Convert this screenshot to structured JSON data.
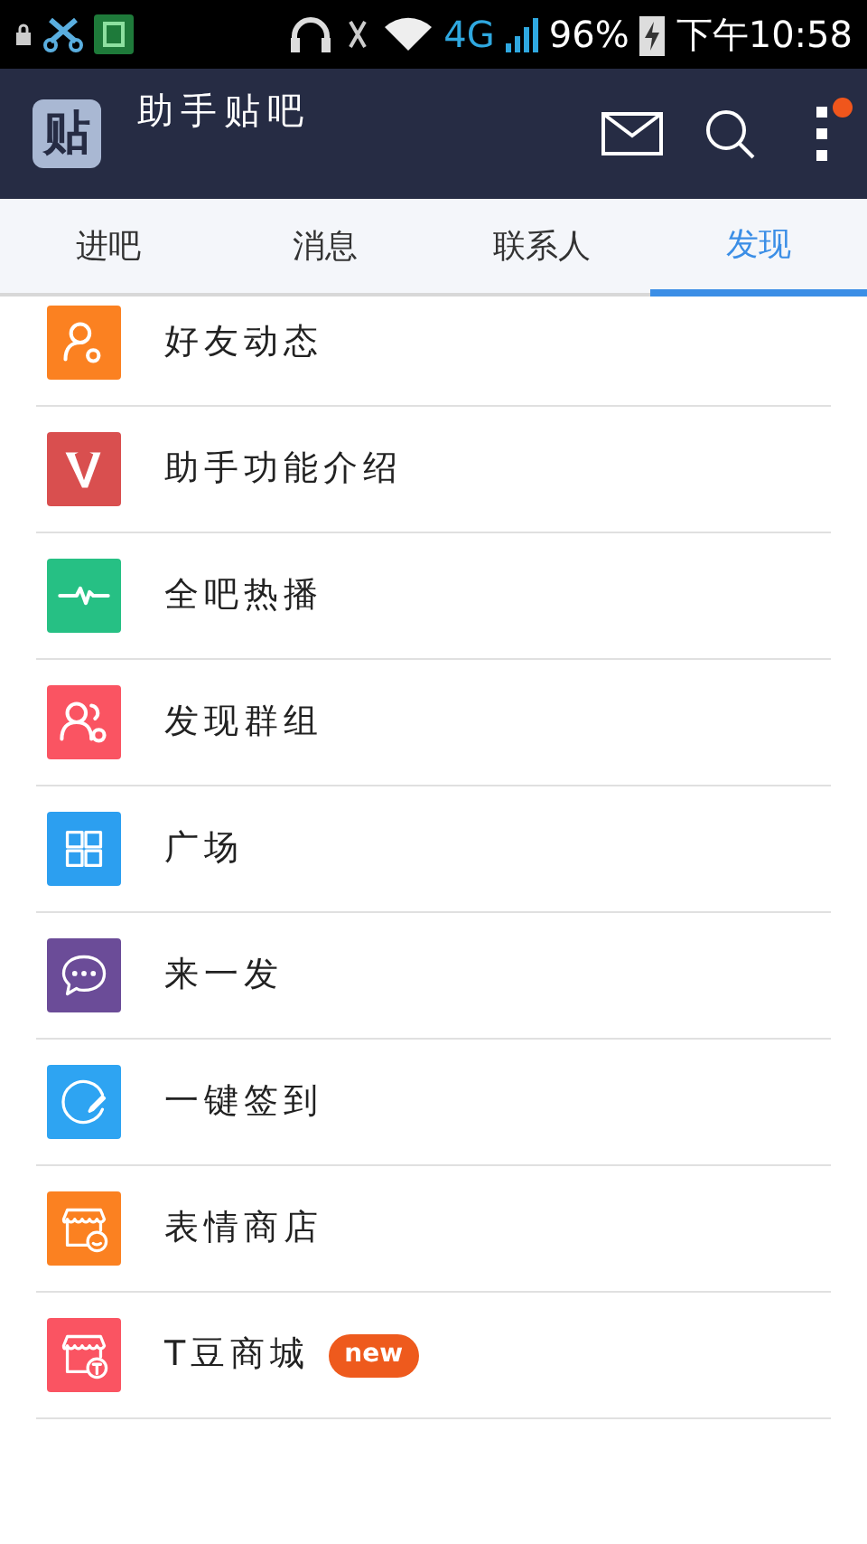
{
  "status_bar": {
    "network": "4G",
    "battery": "96%",
    "time": "下午10:58"
  },
  "app_bar": {
    "logo": "贴",
    "title": "助手贴吧",
    "menu_badge": true
  },
  "tabs": [
    {
      "label": "进吧",
      "selected": false
    },
    {
      "label": "消息",
      "selected": false
    },
    {
      "label": "联系人",
      "selected": false
    },
    {
      "label": "发现",
      "selected": true
    }
  ],
  "items": [
    {
      "label": "好友动态",
      "kind": "person",
      "color": "#fb8121"
    },
    {
      "label": "助手功能介绍",
      "kind": "v",
      "color": "#d94f4f"
    },
    {
      "label": "全吧热播",
      "kind": "pulse",
      "color": "#26c084"
    },
    {
      "label": "发现群组",
      "kind": "group",
      "color": "#fa5462"
    },
    {
      "label": "广场",
      "kind": "grid",
      "color": "#2c9ff0"
    },
    {
      "label": "来一发",
      "kind": "chat",
      "color": "#6b4c98"
    },
    {
      "label": "一键签到",
      "kind": "sign",
      "color": "#2ea4f2"
    },
    {
      "label": "表情商店",
      "kind": "store-smile",
      "color": "#fb8121"
    },
    {
      "label": "T豆商城",
      "kind": "store-t",
      "color": "#fa5462",
      "badge": "new"
    }
  ]
}
